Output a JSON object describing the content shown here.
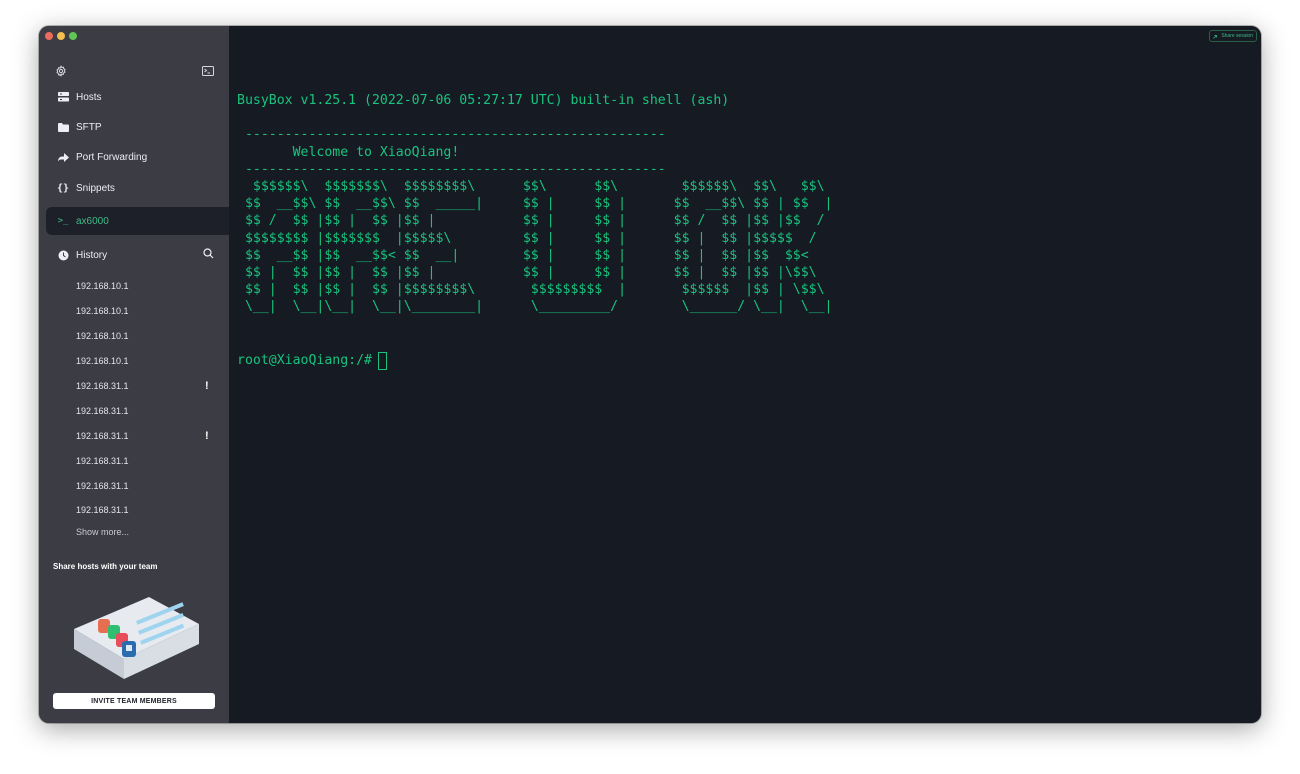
{
  "sidebar": {
    "nav": [
      {
        "label": "Hosts",
        "icon": "hosts-icon"
      },
      {
        "label": "SFTP",
        "icon": "folder-icon"
      },
      {
        "label": "Port Forwarding",
        "icon": "arrow-forward-icon"
      },
      {
        "label": "Snippets",
        "icon": "braces-icon"
      }
    ],
    "active_session": {
      "label": "ax6000",
      "icon": "terminal-icon"
    },
    "history": {
      "label": "History",
      "items": [
        {
          "label": "192.168.10.1",
          "warning": ""
        },
        {
          "label": "192.168.10.1",
          "warning": ""
        },
        {
          "label": "192.168.10.1",
          "warning": ""
        },
        {
          "label": "192.168.10.1",
          "warning": ""
        },
        {
          "label": "192.168.31.1",
          "warning": "!"
        },
        {
          "label": "192.168.31.1",
          "warning": ""
        },
        {
          "label": "192.168.31.1",
          "warning": "!"
        },
        {
          "label": "192.168.31.1",
          "warning": ""
        },
        {
          "label": "192.168.31.1",
          "warning": ""
        },
        {
          "label": "192.168.31.1",
          "warning": ""
        }
      ],
      "show_more": "Show more..."
    },
    "share": {
      "title": "Share hosts with your team",
      "invite_button": "INVITE TEAM MEMBERS"
    }
  },
  "terminal": {
    "share_session": "Share session",
    "lines": [
      "BusyBox v1.25.1 (2022-07-06 05:27:17 UTC) built-in shell (ash)",
      "",
      " -----------------------------------------------------",
      "       Welcome to XiaoQiang!",
      " -----------------------------------------------------",
      "  $$$$$$\\  $$$$$$$\\  $$$$$$$$\\      $$\\      $$\\        $$$$$$\\  $$\\   $$\\",
      " $$  __$$\\ $$  __$$\\ $$  _____|     $$ |     $$ |      $$  __$$\\ $$ | $$  |",
      " $$ /  $$ |$$ |  $$ |$$ |           $$ |     $$ |      $$ /  $$ |$$ |$$  /",
      " $$$$$$$$ |$$$$$$$  |$$$$$\\         $$ |     $$ |      $$ |  $$ |$$$$$  /",
      " $$  __$$ |$$  __$$< $$  __|        $$ |     $$ |      $$ |  $$ |$$  $$<",
      " $$ |  $$ |$$ |  $$ |$$ |           $$ |     $$ |      $$ |  $$ |$$ |\\$$\\",
      " $$ |  $$ |$$ |  $$ |$$$$$$$$\\       $$$$$$$$$  |       $$$$$$  |$$ | \\$$\\",
      " \\__|  \\__|\\__|  \\__|\\________|      \\_________/        \\______/ \\__|  \\__|"
    ],
    "prompt": "root@XiaoQiang:/#"
  },
  "colors": {
    "terminal_text": "#19c37d",
    "accent": "#3fbb86",
    "sidebar_bg": "#3b3c44",
    "terminal_bg": "#161a23"
  }
}
